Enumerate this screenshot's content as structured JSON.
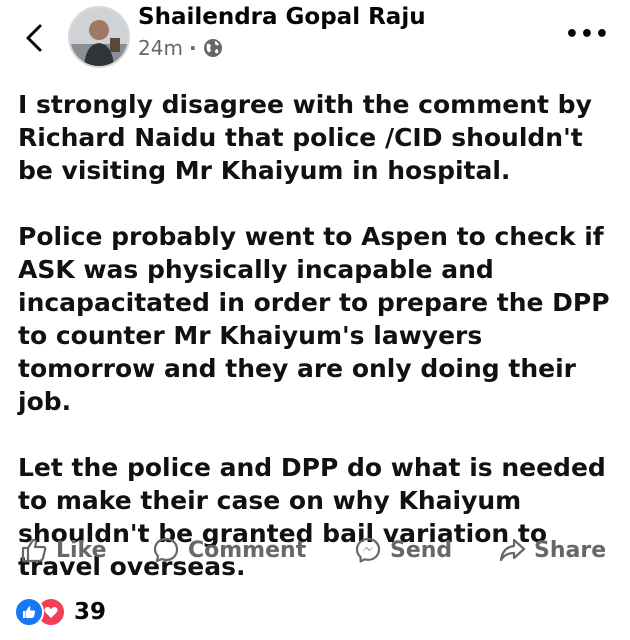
{
  "post": {
    "author": "Shailendra Gopal Raju",
    "time": "24m",
    "separator": "·",
    "audience_icon": "globe-icon",
    "paragraphs": [
      "I strongly disagree with the comment by Richard Naidu that police /CID shouldn't be visiting Mr Khaiyum in hospital.",
      "Police probably went to Aspen to check if ASK was physically incapable and incapacitated in order to prepare the DPP to counter Mr Khaiyum's lawyers tomorrow and they are only doing their job.",
      "Let the police and DPP do what is needed to make their case on why Khaiyum shouldn't be granted bail variation to travel overseas."
    ]
  },
  "actions": {
    "like": "Like",
    "comment": "Comment",
    "send": "Send",
    "share": "Share"
  },
  "reactions": {
    "count": "39",
    "types": [
      "like-reaction-icon",
      "love-reaction-icon"
    ]
  },
  "colors": {
    "text": "#050505",
    "secondary": "#65676b",
    "like_blue": "#1877f2",
    "love_red": "#f33e58"
  }
}
